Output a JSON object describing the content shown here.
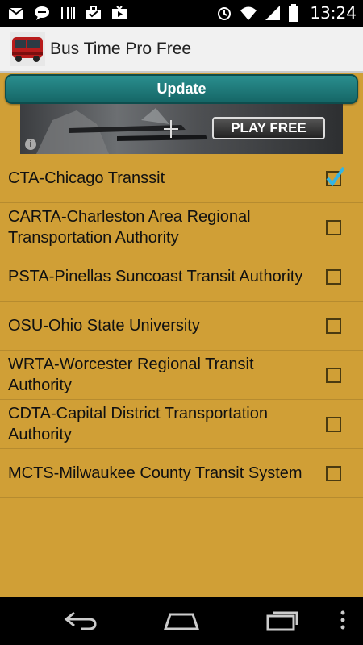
{
  "status_bar": {
    "time": "13:24",
    "left_icons": [
      "gmail-icon",
      "chat-icon",
      "barcode-icon",
      "briefcase-icon",
      "play-store-icon"
    ],
    "right_icons": [
      "alarm-icon",
      "wifi-icon",
      "signal-icon",
      "battery-icon"
    ]
  },
  "app_bar": {
    "title": "Bus Time Pro Free"
  },
  "update_button": {
    "label": "Update"
  },
  "ad": {
    "cta_label": "PLAY FREE",
    "info_label": "i"
  },
  "agencies": [
    {
      "label": "CTA-Chicago Transsit",
      "checked": true
    },
    {
      "label": "CARTA-Charleston Area Regional Transportation Authority",
      "checked": false
    },
    {
      "label": "PSTA-Pinellas Suncoast Transit Authority",
      "checked": false
    },
    {
      "label": "OSU-Ohio State University",
      "checked": false
    },
    {
      "label": "WRTA-Worcester Regional Transit Authority",
      "checked": false
    },
    {
      "label": "CDTA-Capital District Transportation Authority",
      "checked": false
    },
    {
      "label": "MCTS-Milwaukee County Transit System",
      "checked": false
    }
  ],
  "nav_bar": {
    "buttons": [
      "back-icon",
      "home-icon",
      "recents-icon",
      "menu-icon"
    ]
  },
  "colors": {
    "background": "#d09f36",
    "update_button": "#1f7a7a",
    "check_accent": "#33b5e5"
  }
}
